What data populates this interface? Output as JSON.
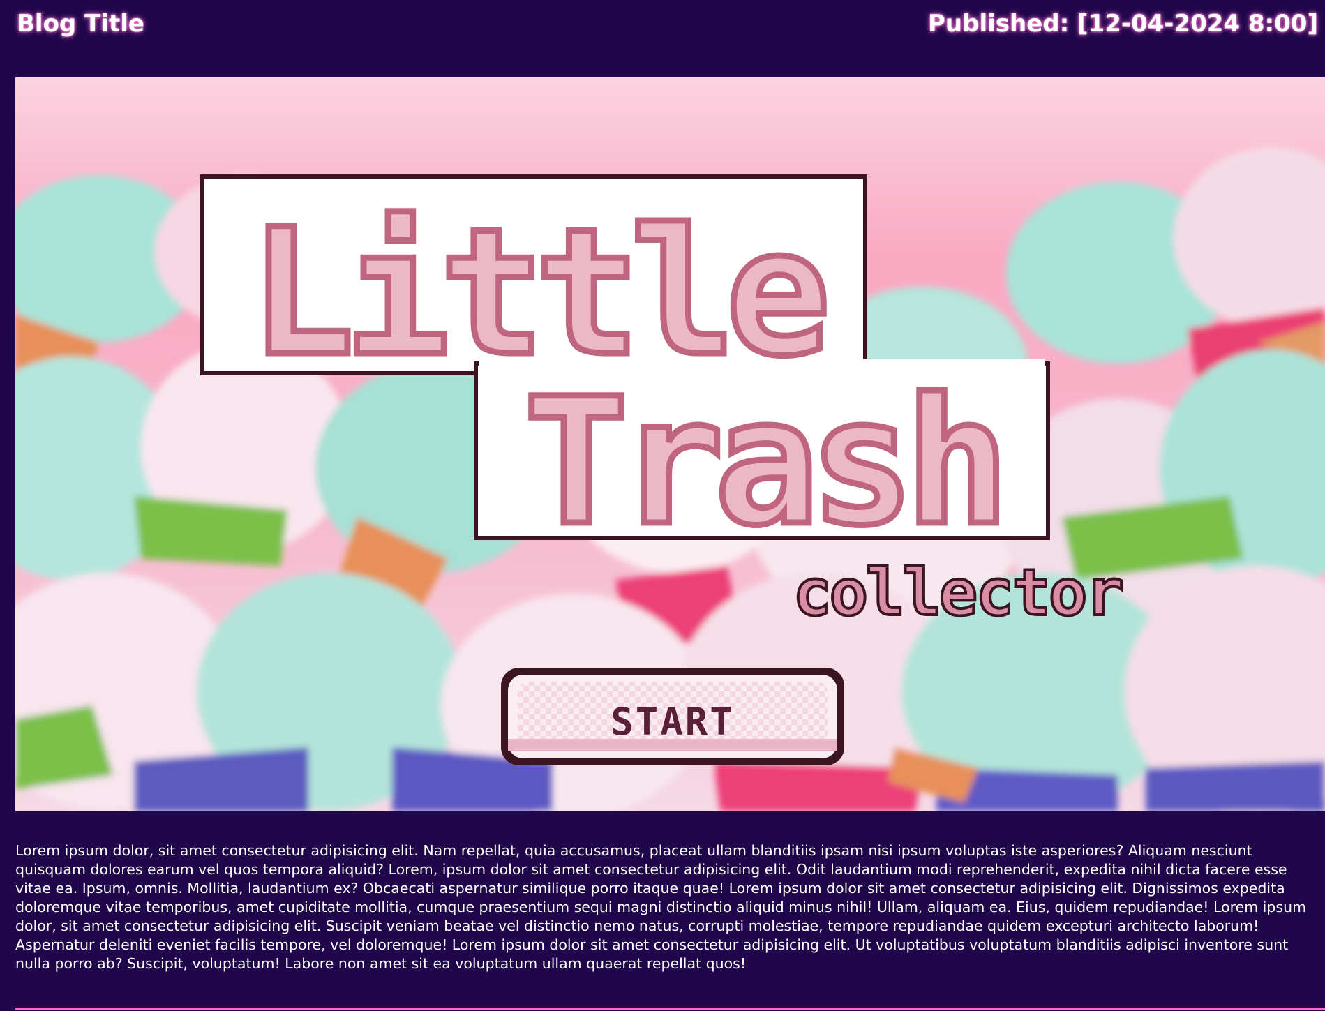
{
  "header": {
    "blog_title": "Blog Title",
    "published": "Published: [12-04-2024 8:00]"
  },
  "banner": {
    "logo_line1": "Little",
    "logo_line2": "Trash",
    "logo_subtitle": "collector",
    "start_label": "START"
  },
  "article": {
    "body": "Lorem ipsum dolor, sit amet consectetur adipisicing elit. Nam repellat, quia accusamus, placeat ullam blanditiis ipsam nisi ipsum voluptas iste asperiores? Aliquam nesciunt quisquam dolores earum vel quos tempora aliquid? Lorem, ipsum dolor sit amet consectetur adipisicing elit. Odit laudantium modi reprehenderit, expedita nihil dicta facere esse vitae ea. Ipsum, omnis. Mollitia, laudantium ex? Obcaecati aspernatur similique porro itaque quae! Lorem ipsum dolor sit amet consectetur adipisicing elit. Dignissimos expedita doloremque vitae temporibus, amet cupiditate mollitia, cumque praesentium sequi magni distinctio aliquid minus nihil! Ullam, aliquam ea. Eius, quidem repudiandae! Lorem ipsum dolor, sit amet consectetur adipisicing elit. Suscipit veniam beatae vel distinctio nemo natus, corrupti molestiae, tempore repudiandae quidem excepturi architecto laborum! Aspernatur deleniti eveniet facilis tempore, vel doloremque! Lorem ipsum dolor sit amet consectetur adipisicing elit. Ut voluptatibus voluptatum blanditiis adipisci inventore sunt nulla porro ab? Suscipit, voluptatum! Labore non amet sit ea voluptatum ullam quaerat repellat quos!"
  },
  "colors": {
    "page_bg": "#20064a",
    "accent_glow": "#ff6fd0",
    "logo_pink": "#e8a9be",
    "logo_outline": "#8e3f5b",
    "start_text": "#5a2038"
  }
}
